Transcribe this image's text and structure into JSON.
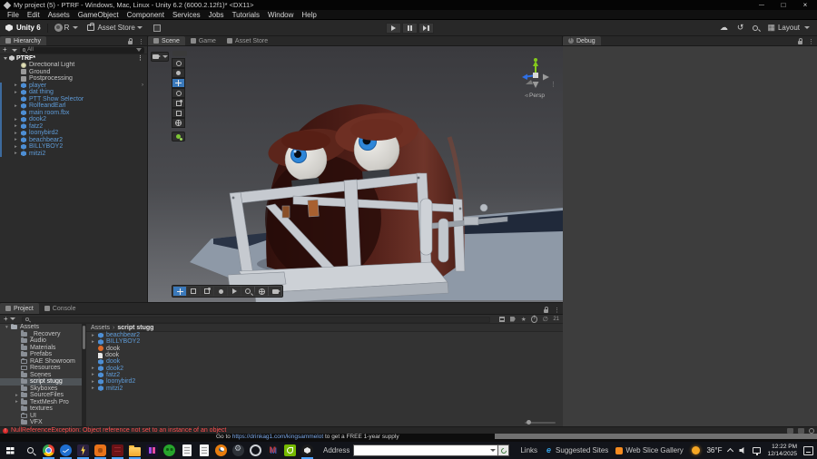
{
  "window": {
    "title": "My project (5) - PTRF - Windows, Mac, Linux - Unity 6.2 (6000.2.12f1)* <DX11>"
  },
  "menu": {
    "items": [
      "File",
      "Edit",
      "Assets",
      "GameObject",
      "Component",
      "Services",
      "Jobs",
      "Tutorials",
      "Window",
      "Help"
    ]
  },
  "toolbar": {
    "unity_version": "Unity 6",
    "account_initial": "R",
    "asset_store_label": "Asset Store",
    "layout_label": "Layout"
  },
  "hierarchy": {
    "tab_label": "Hierarchy",
    "create_button": "+",
    "search_text": "All",
    "scene_name": "PTRF*",
    "items": [
      {
        "label": "Directional Light",
        "cls": "plain light"
      },
      {
        "label": "Ground",
        "cls": "plain"
      },
      {
        "label": "Postprocessing",
        "cls": "plain"
      },
      {
        "label": "player",
        "cls": "prefab arrow chev"
      },
      {
        "label": "dat thing",
        "cls": "prefab arrow"
      },
      {
        "label": "PTT Show Selector",
        "cls": "prefab"
      },
      {
        "label": "RolfeandEarl",
        "cls": "prefab arrow"
      },
      {
        "label": "main room.fbx",
        "cls": "prefab"
      },
      {
        "label": "dook2",
        "cls": "prefab arrow"
      },
      {
        "label": "fatz2",
        "cls": "prefab arrow"
      },
      {
        "label": "loonybird2",
        "cls": "prefab arrow"
      },
      {
        "label": "beachbear2",
        "cls": "prefab arrow"
      },
      {
        "label": "BILLYBOY2",
        "cls": "prefab arrow"
      },
      {
        "label": "mitzi2",
        "cls": "prefab arrow"
      }
    ]
  },
  "scene_view": {
    "tabs": [
      {
        "label": "Scene",
        "cls": "active",
        "icon": "scene-tab-icon"
      },
      {
        "label": "Game",
        "cls": "",
        "icon": "game-tab-icon"
      },
      {
        "label": "Asset Store",
        "cls": "",
        "icon": "asset-store-tab-icon"
      }
    ],
    "persp_label": "Persp"
  },
  "debug_panel": {
    "tab_label": "Debug"
  },
  "project": {
    "tab_project": "Project",
    "tab_console": "Console",
    "create_button": "+",
    "hidden_count": "21",
    "breadcrumb": {
      "root": "Assets",
      "current": "script stugg"
    },
    "folders": [
      {
        "label": "Assets",
        "cls": "open d0"
      },
      {
        "label": "_Recovery",
        "cls": "d1"
      },
      {
        "label": "Audio",
        "cls": "d1"
      },
      {
        "label": "Materials",
        "cls": "d1"
      },
      {
        "label": "Prefabs",
        "cls": "d1"
      },
      {
        "label": "RAE Showroom",
        "cls": "d1 empty"
      },
      {
        "label": "Resources",
        "cls": "d1 empty"
      },
      {
        "label": "Scenes",
        "cls": "d1"
      },
      {
        "label": "script stugg",
        "cls": "d1 sel"
      },
      {
        "label": "Skyboxes",
        "cls": "d1"
      },
      {
        "label": "SourceFiles",
        "cls": "d1 arrow"
      },
      {
        "label": "TextMesh Pro",
        "cls": "d1 arrow"
      },
      {
        "label": "textures",
        "cls": "d1"
      },
      {
        "label": "UI",
        "cls": "d1 empty"
      },
      {
        "label": "VFX",
        "cls": "d1"
      }
    ],
    "assets": [
      {
        "label": "beachbear2",
        "cls": "arrow",
        "icon": "prefab"
      },
      {
        "label": "BILLYBOY2",
        "cls": "arrow",
        "icon": "prefab"
      },
      {
        "label": "dook",
        "cls": "greylabel",
        "icon": "orange"
      },
      {
        "label": "dook",
        "cls": "greylabel",
        "icon": "doc"
      },
      {
        "label": "dook",
        "cls": "",
        "icon": "prefab"
      },
      {
        "label": "dook2",
        "cls": "arrow",
        "icon": "prefab"
      },
      {
        "label": "fatz2",
        "cls": "arrow",
        "icon": "prefab"
      },
      {
        "label": "loonybird2",
        "cls": "arrow",
        "icon": "prefab"
      },
      {
        "label": "mitzi2",
        "cls": "arrow",
        "icon": "prefab"
      }
    ]
  },
  "status_bar": {
    "error_message": "NullReferenceException: Object reference not set to an instance of an object"
  },
  "background_window": {
    "ad_text_prefix": "Go to ",
    "ad_url": "https://drinkag1.com/kingsammelot",
    "ad_text_suffix": " to get a FREE 1-year supply"
  },
  "taskbar": {
    "address_label": "Address",
    "address_value": "",
    "links_label": "Links",
    "suggested_sites_label": "Suggested Sites",
    "web_slice_label": "Web Slice Gallery",
    "icons": [
      {
        "name": "chrome-icon",
        "cls": "i-chrome running"
      },
      {
        "name": "blue-check-app-icon",
        "cls": "i-blue running"
      },
      {
        "name": "lightning-app-icon",
        "cls": "i-bolt running"
      },
      {
        "name": "orange-app-icon",
        "cls": "i-orange running"
      },
      {
        "name": "red-game-icon",
        "cls": "i-red running"
      },
      {
        "name": "file-explorer-icon",
        "cls": "i-folder running"
      },
      {
        "name": "purple-game-icon",
        "cls": "i-rr"
      },
      {
        "name": "green-app-icon",
        "cls": "i-alien"
      },
      {
        "name": "notepad-icon",
        "cls": "i-doc"
      },
      {
        "name": "notepad-icon-2",
        "cls": "i-doc"
      },
      {
        "name": "blender-icon",
        "cls": "i-blender"
      },
      {
        "name": "gear-app-icon",
        "cls": "i-gear"
      },
      {
        "name": "ring-app-icon",
        "cls": "i-ring"
      },
      {
        "name": "m-app-icon",
        "cls": "i-m"
      },
      {
        "name": "nvidia-icon",
        "cls": "i-nvidia"
      },
      {
        "name": "unity-taskbar-icon",
        "cls": "i-unity running"
      }
    ],
    "tray": {
      "temperature": "36°F",
      "time": "12:22 PM",
      "date": "12/14/2025"
    }
  }
}
